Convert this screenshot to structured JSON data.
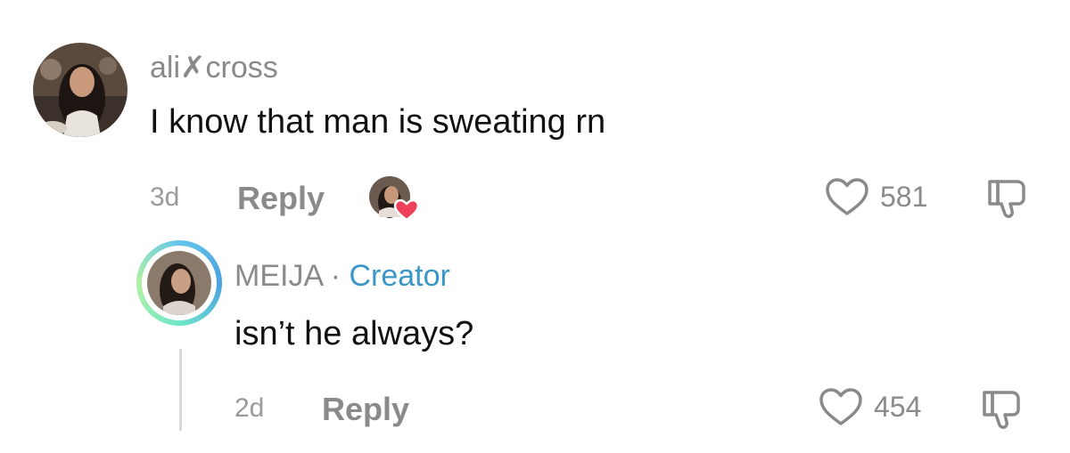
{
  "comments": [
    {
      "username": "ali✗cross",
      "text": "I know that man is sweating rn",
      "time": "3d",
      "reply_label": "Reply",
      "likes": "581"
    }
  ],
  "reply": {
    "username": "MEIJA",
    "separator": "·",
    "creator_label": "Creator",
    "text": "isn’t he always?",
    "time": "2d",
    "reply_label": "Reply",
    "likes": "454"
  },
  "colors": {
    "creator_blue": "#3b96c8",
    "meta_gray": "#8a8a8a",
    "heart_red": "#ef3f5a"
  },
  "icons": [
    "heart-outline-icon",
    "thumbs-down-icon",
    "creator-liked-heart-icon"
  ]
}
